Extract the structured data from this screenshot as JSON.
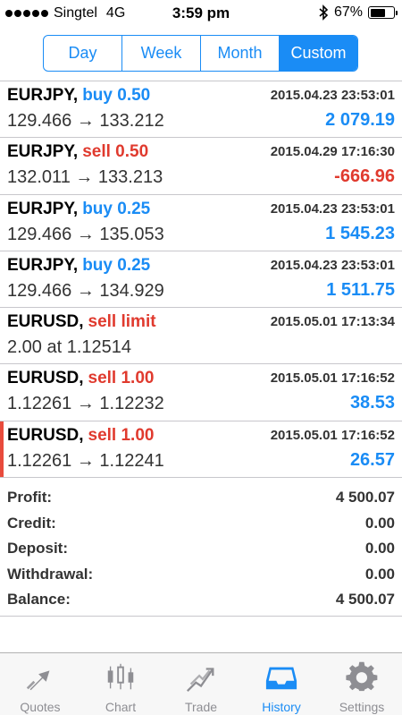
{
  "status": {
    "carrier": "Singtel",
    "network": "4G",
    "time": "3:59 pm",
    "battery_text": "67%",
    "battery_level": 0.67,
    "icons": [
      "signal-dots-icon",
      "bluetooth-icon",
      "battery-icon"
    ]
  },
  "period_tabs": [
    {
      "label": "Day",
      "active": false
    },
    {
      "label": "Week",
      "active": false
    },
    {
      "label": "Month",
      "active": false
    },
    {
      "label": "Custom",
      "active": true
    }
  ],
  "deals": [
    {
      "symbol": "EURJPY,",
      "action": "buy 0.50",
      "type": "buy",
      "date": "2015.04.23 23:53:01",
      "prices": "129.466 → 133.212",
      "profit": "2 079.19",
      "profit_sign": "pos"
    },
    {
      "symbol": "EURJPY,",
      "action": "sell 0.50",
      "type": "sell",
      "date": "2015.04.29 17:16:30",
      "prices": "132.011 → 133.213",
      "profit": "-666.96",
      "profit_sign": "neg"
    },
    {
      "symbol": "EURJPY,",
      "action": "buy 0.25",
      "type": "buy",
      "date": "2015.04.23 23:53:01",
      "prices": "129.466 → 135.053",
      "profit": "1 545.23",
      "profit_sign": "pos"
    },
    {
      "symbol": "EURJPY,",
      "action": "buy 0.25",
      "type": "buy",
      "date": "2015.04.23 23:53:01",
      "prices": "129.466 → 134.929",
      "profit": "1 511.75",
      "profit_sign": "pos"
    },
    {
      "symbol": "EURUSD,",
      "action": "sell limit",
      "type": "sell",
      "date": "2015.05.01 17:13:34",
      "prices": "2.00 at 1.12514",
      "profit": "",
      "profit_sign": "pos"
    },
    {
      "symbol": "EURUSD,",
      "action": "sell 1.00",
      "type": "sell",
      "date": "2015.05.01 17:16:52",
      "prices": "1.12261 → 1.12232",
      "profit": "38.53",
      "profit_sign": "pos"
    },
    {
      "symbol": "EURUSD,",
      "action": "sell 1.00",
      "type": "sell",
      "date": "2015.05.01 17:16:52",
      "prices": "1.12261 → 1.12241",
      "profit": "26.57",
      "profit_sign": "pos",
      "selected": true
    }
  ],
  "summary": [
    {
      "label": "Profit:",
      "value": "4 500.07"
    },
    {
      "label": "Credit:",
      "value": "0.00"
    },
    {
      "label": "Deposit:",
      "value": "0.00"
    },
    {
      "label": "Withdrawal:",
      "value": "0.00"
    },
    {
      "label": "Balance:",
      "value": "4 500.07"
    }
  ],
  "tabbar": [
    {
      "label": "Quotes",
      "icon": "quotes-icon",
      "active": false
    },
    {
      "label": "Chart",
      "icon": "chart-icon",
      "active": false
    },
    {
      "label": "Trade",
      "icon": "trade-icon",
      "active": false
    },
    {
      "label": "History",
      "icon": "history-icon",
      "active": true
    },
    {
      "label": "Settings",
      "icon": "settings-icon",
      "active": false
    }
  ],
  "colors": {
    "accent": "#1a8cf5",
    "sell": "#e03a2e",
    "selected_marker": "#e84b3c",
    "inactive_tab": "#8e8e93"
  }
}
